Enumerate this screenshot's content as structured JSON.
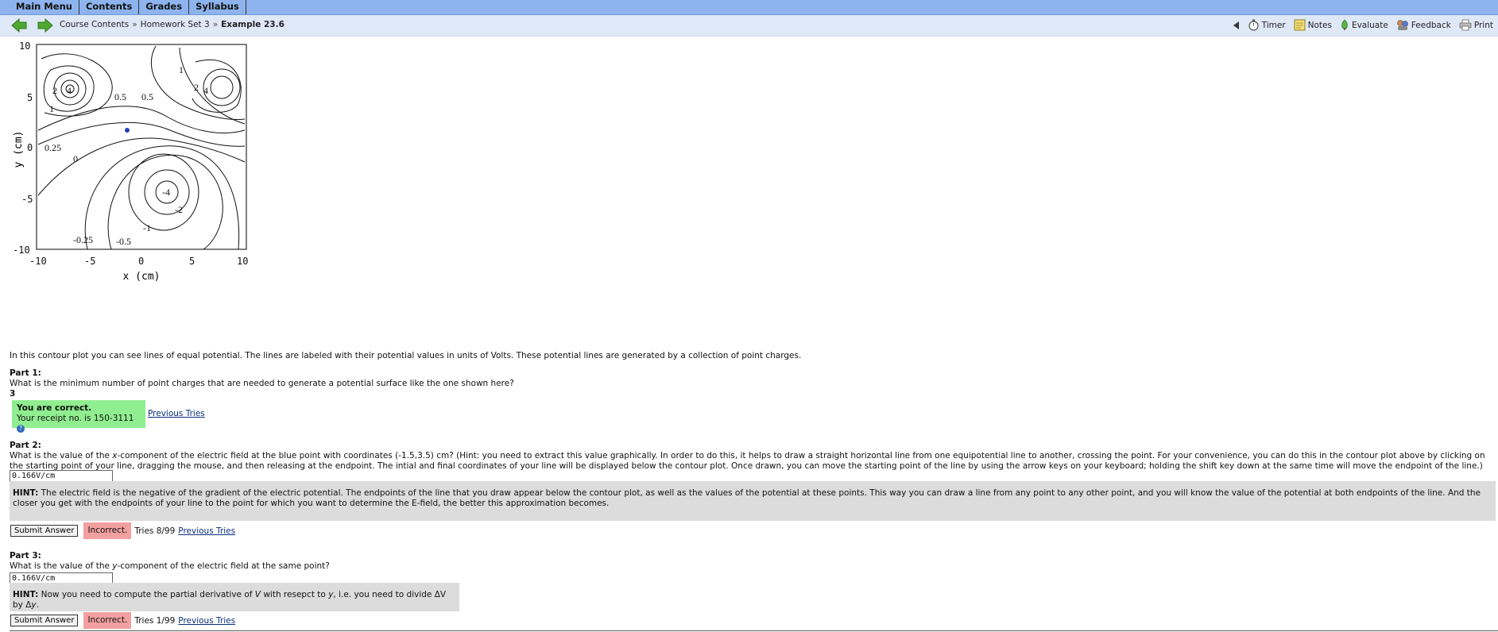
{
  "topnav": {
    "items": [
      "Main Menu",
      "Contents",
      "Grades",
      "Syllabus"
    ]
  },
  "breadcrumb": {
    "items": [
      "Course Contents",
      "Homework Set 3"
    ],
    "current": "Example 23.6",
    "separator": "»"
  },
  "tools": {
    "items": [
      {
        "label": "Timer",
        "icon": "timer-icon"
      },
      {
        "label": "Notes",
        "icon": "notes-icon"
      },
      {
        "label": "Evaluate",
        "icon": "evaluate-icon"
      },
      {
        "label": "Feedback",
        "icon": "feedback-icon"
      },
      {
        "label": "Print",
        "icon": "print-icon"
      }
    ]
  },
  "plot": {
    "xlabel": "x (cm)",
    "ylabel": "y (cm)",
    "xticks": [
      "-10",
      "-5",
      "0",
      "5",
      "10"
    ],
    "yticks": [
      "10",
      "5",
      "0",
      "-5",
      "-10"
    ],
    "contour_labels": [
      "2",
      "4",
      "1",
      "0.5",
      "0.5",
      "1",
      "2",
      "4",
      "0.25",
      "0",
      "-4",
      "-2",
      "-1",
      "-0.25",
      "-0.5"
    ],
    "blue_point": {
      "x": -1.5,
      "y": 3.5
    },
    "point_color": "#1f3fbf"
  },
  "intro": "In this contour plot you can see lines of equal potential. The lines are labeled with their potential values in units of Volts. These potential lines are generated by a collection of point charges.",
  "part1": {
    "label": "Part 1:",
    "question": "What is the minimum number of point charges that are needed to generate a potential surface like the one shown here?",
    "answer": "3",
    "status": "You are correct.",
    "receipt": "Your receipt no. is 150-3111",
    "previous_tries": "Previous Tries"
  },
  "part2": {
    "label": "Part 2:",
    "q_before": "What is the value of the ",
    "q_var": "x",
    "q_after": "-component of the electric field at the blue point with coordinates (-1.5,3.5) cm? (Hint: you need to extract this value graphically. In order to do this, it helps to draw a straight horizontal line from one equipotential line to another, crossing the point. For your convenience, you can do this in the contour plot above by clicking on the starting point of your line, dragging the mouse, and then releasing at the endpoint. The intial and final coordinates of your line will be displayed below the contour plot. Once drawn, you can move the starting point of the line by using the arrow keys on your keyboard; holding the shift key down at the same time will move the endpoint of the line.)",
    "input_value": "0.166V/cm",
    "hint_label": "HINT:",
    "hint": " The electric field is the negative of the gradient of the electric potential. The endpoints of the line that you draw appear below the contour plot, as well as the values of the potential at these points. This way you can draw a line from any point to any other point, and you will know the value of the potential at both endpoints of the line. And the closer you get with the endpoints of your line to the point for which you want to determine the E-field, the better this approximation becomes.",
    "submit": "Submit Answer",
    "status": "Incorrect.",
    "tries": "Tries 8/99",
    "previous_tries": "Previous Tries"
  },
  "part3": {
    "label": "Part 3:",
    "q_before": "What is the value of the ",
    "q_var": "y",
    "q_after": "-component of the electric field at the same point?",
    "input_value": "0.166V/cm",
    "hint_label": "HINT:",
    "hint_a": " Now you need to compute the partial derivative of ",
    "hint_v": "V",
    "hint_b": " with resepct to ",
    "hint_y": "y",
    "hint_c": ", i.e. you need to divide ΔV by Δ",
    "hint_y2": "y",
    "hint_d": ".",
    "submit": "Submit Answer",
    "status": "Incorrect.",
    "tries": "Tries 1/99",
    "previous_tries": "Previous Tries"
  },
  "colors": {
    "topbar": "#8db4ef",
    "navbar": "#dfe8f7",
    "correct": "#90ee90",
    "incorrect": "#f3a0a0",
    "hint": "#dcdcdc",
    "arrow": "#4ea832"
  }
}
